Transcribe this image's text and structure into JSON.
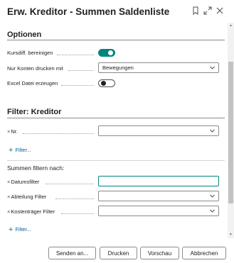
{
  "dialog": {
    "title": "Erw. Kreditor - Summen Saldenliste",
    "header_icons": [
      "bookmark-icon",
      "expand-icon",
      "close-icon"
    ]
  },
  "options": {
    "title": "Optionen",
    "fields": [
      {
        "label": "Kursdiff. bereinigen",
        "type": "toggle",
        "value": true
      },
      {
        "label": "Nur Konten drucken mit",
        "type": "select",
        "value": "Bewegungen"
      },
      {
        "label": "Excel Datei erzeugen",
        "type": "toggle",
        "value": false
      }
    ]
  },
  "filter_kreditor": {
    "title": "Filter: Kreditor",
    "fields": [
      {
        "label": "Nr.",
        "value": ""
      }
    ],
    "add_filter_label": "Filter..."
  },
  "summen_filter": {
    "title": "Summen filtern nach:",
    "fields": [
      {
        "label": "Datumsfilter",
        "value": ""
      },
      {
        "label": "Abteilung Filter",
        "value": ""
      },
      {
        "label": "Kostenträger Filter",
        "value": ""
      }
    ],
    "add_filter_label": "Filter..."
  },
  "buttons": {
    "send": "Senden an...",
    "print": "Drucken",
    "preview": "Vorschau",
    "cancel": "Abbrechen"
  },
  "colors": {
    "accent": "#00857d",
    "link": "#005a9e",
    "text": "#212121"
  }
}
